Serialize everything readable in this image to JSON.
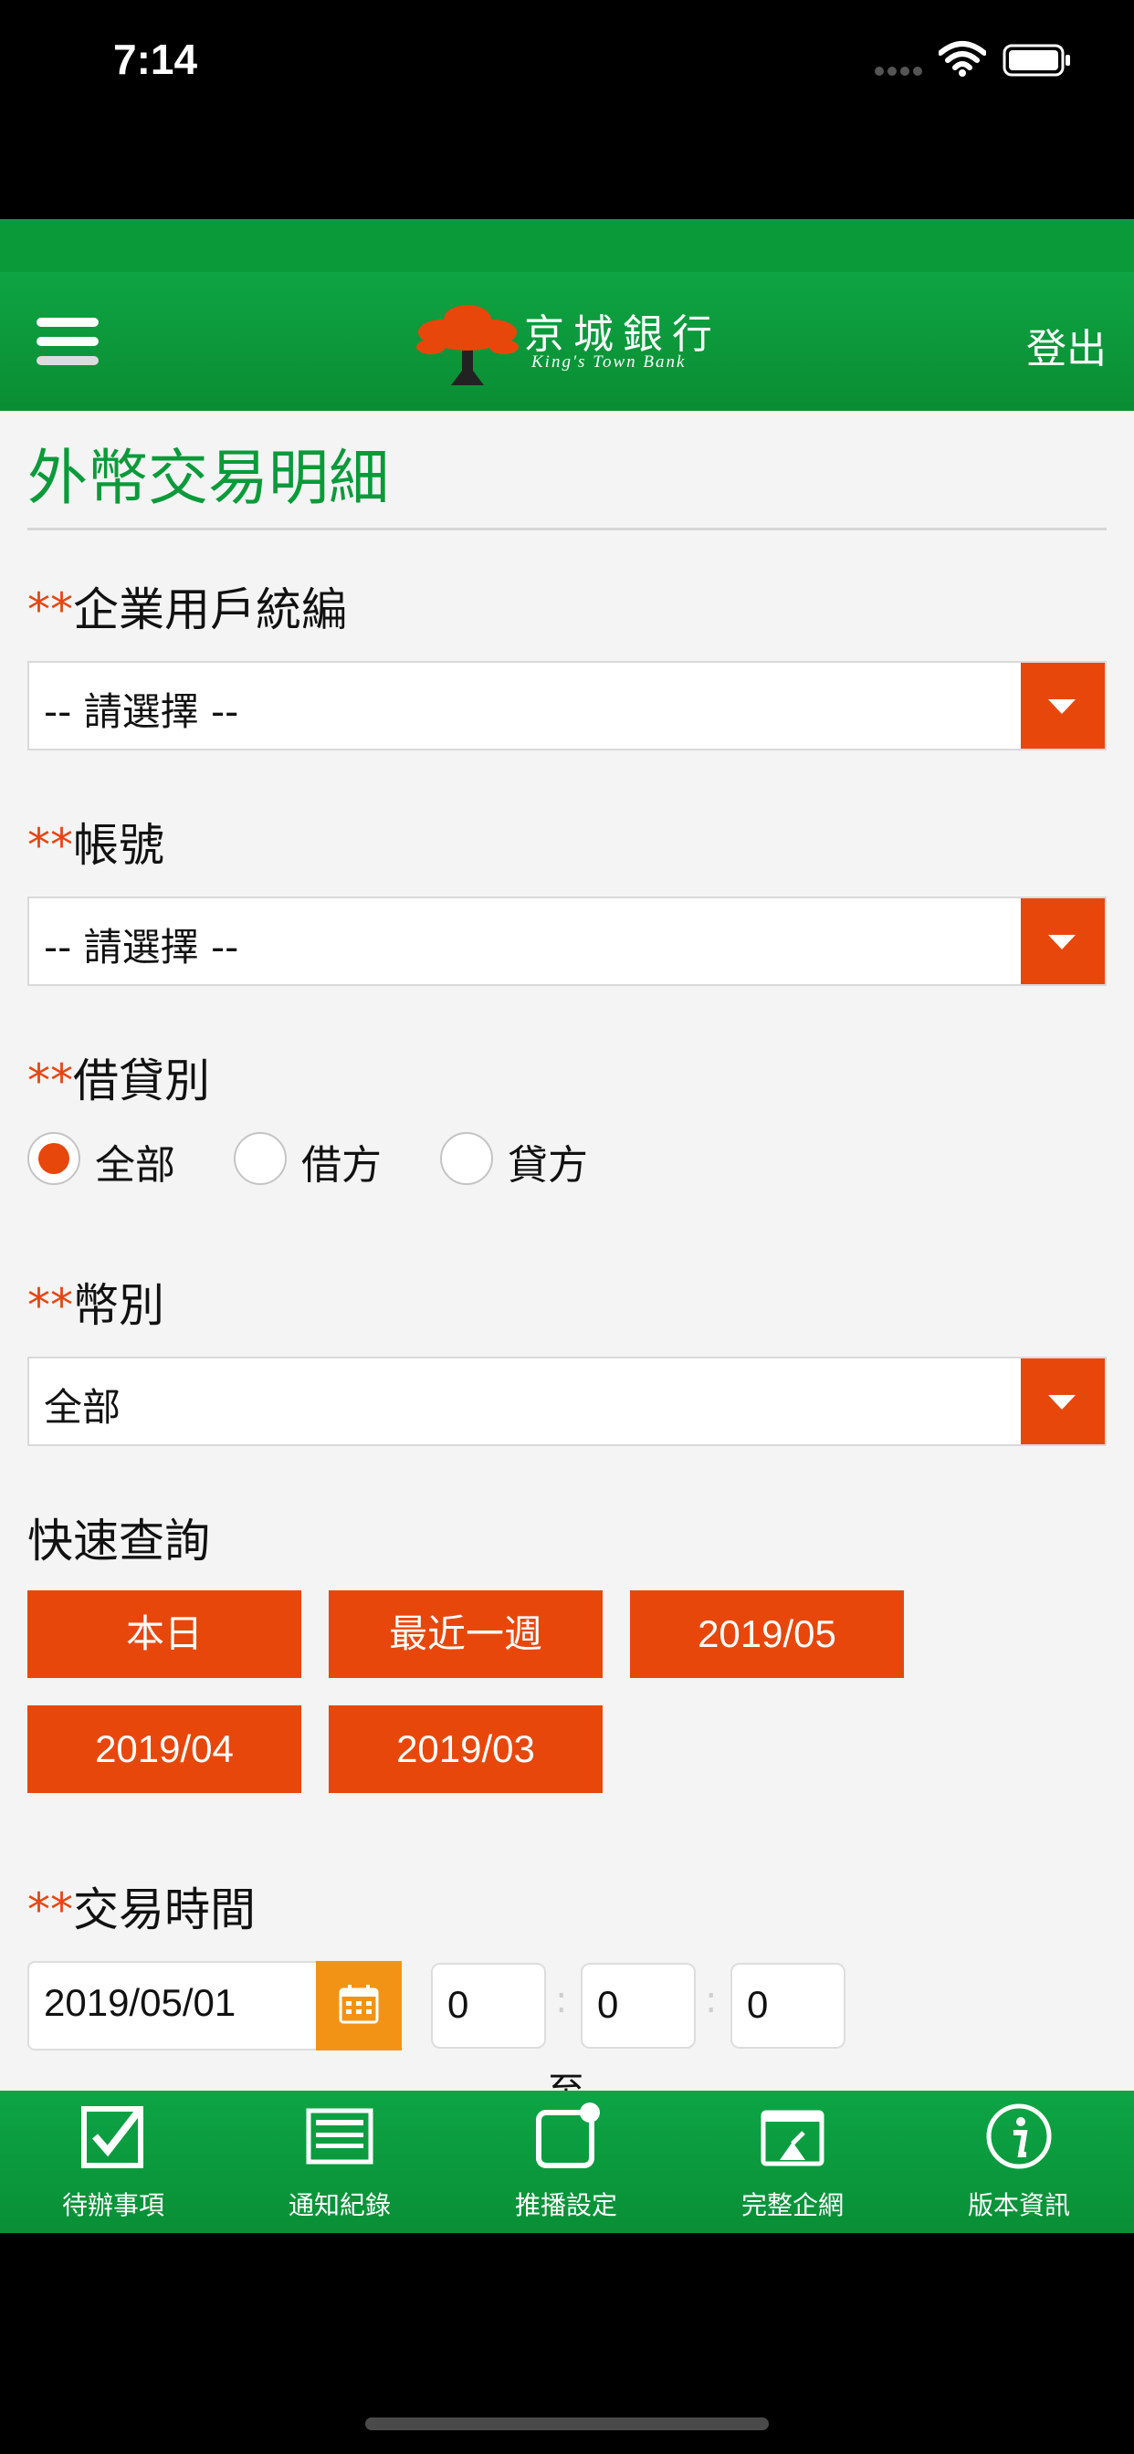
{
  "status_bar": {
    "time": "7:14"
  },
  "header": {
    "brand_cn": "京城銀行",
    "brand_en": "King's Town Bank",
    "logout_label": "登出"
  },
  "page": {
    "title": "外幣交易明細"
  },
  "form": {
    "required_mark": "**",
    "company_id": {
      "label": "企業用戶統編",
      "value": "-- 請選擇 --"
    },
    "account": {
      "label": "帳號",
      "value": "-- 請選擇 --"
    },
    "debit_credit": {
      "label": "借貸別",
      "options": [
        {
          "label": "全部",
          "selected": true
        },
        {
          "label": "借方",
          "selected": false
        },
        {
          "label": "貸方",
          "selected": false
        }
      ]
    },
    "currency": {
      "label": "幣別",
      "value": "全部"
    },
    "quick_query": {
      "label": "快速查詢",
      "buttons": [
        "本日",
        "最近一週",
        "2019/05",
        "2019/04",
        "2019/03"
      ]
    },
    "transaction_time": {
      "label": "交易時間",
      "date": "2019/05/01",
      "hour": "0",
      "minute": "0",
      "second": "0",
      "separator": ":",
      "to_label": "至"
    }
  },
  "tab_bar": {
    "items": [
      {
        "label": "待辦事項",
        "icon": "checkbox-icon"
      },
      {
        "label": "通知紀錄",
        "icon": "list-icon"
      },
      {
        "label": "推播設定",
        "icon": "push-notification-icon"
      },
      {
        "label": "完整企網",
        "icon": "web-icon"
      },
      {
        "label": "版本資訊",
        "icon": "info-icon"
      }
    ]
  },
  "colors": {
    "brand_green": "#0a9a3a",
    "accent_orange": "#e8470c",
    "calendar_orange": "#f39315"
  }
}
